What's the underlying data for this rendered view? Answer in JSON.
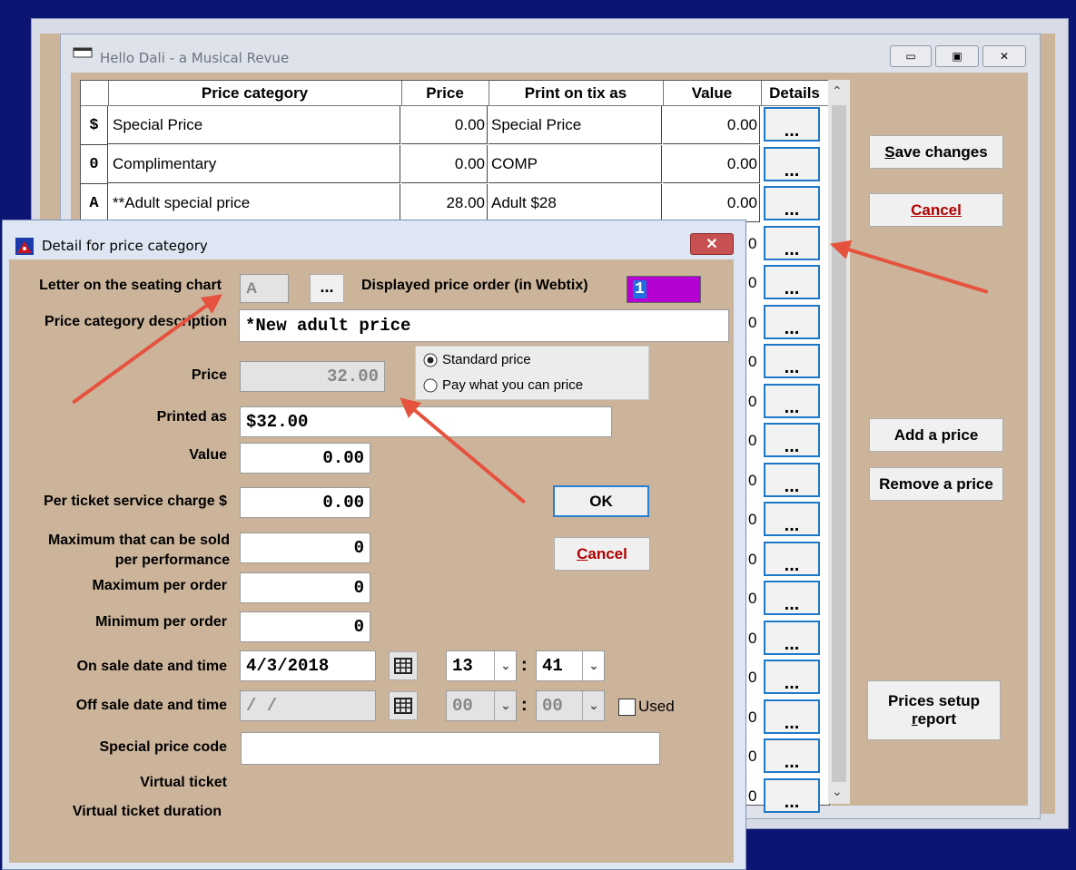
{
  "main_window": {
    "title": "Hello Dali - a Musical Revue",
    "grid": {
      "headers": [
        "Price category",
        "Price",
        "Print on tix as",
        "Value",
        "Details"
      ],
      "rows": [
        {
          "letter": "$",
          "category": "Special Price",
          "price": "0.00",
          "print": "Special Price",
          "value": "0.00"
        },
        {
          "letter": "0",
          "category": "Complimentary",
          "price": "0.00",
          "print": "COMP",
          "value": "0.00"
        },
        {
          "letter": "A",
          "category": "**Adult special price",
          "price": "28.00",
          "print": "Adult $28",
          "value": "0.00"
        }
      ],
      "hidden_value_suffix": "0",
      "details_label": "..."
    },
    "buttons": {
      "save_key": "S",
      "save_rest": "ave changes",
      "cancel_key": "C",
      "cancel_rest": "ancel",
      "add": "Add a price",
      "remove": "Remove a price",
      "report_line1": "Prices setup",
      "report_line2_key": "r",
      "report_line2_rest": "eport"
    }
  },
  "dialog": {
    "title": "Detail for price category",
    "letter_label": "Letter on the seating chart",
    "letter_value": "A",
    "ellipsis": "...",
    "order_label": "Displayed price order (in Webtix)",
    "order_value": "1",
    "desc_label": "Price category description",
    "desc_value": "*New adult price",
    "price_type_options": [
      "Standard price",
      "Pay what you can price"
    ],
    "price_type_selected": "Standard price",
    "price_label": "Price",
    "price_value": "32.00",
    "printed_label": "Printed as",
    "printed_value": "$32.00",
    "value_label": "Value",
    "value_value": "0.00",
    "service_label": "Per ticket service charge  $",
    "service_value": "0.00",
    "max_perf_label1": "Maximum that can be sold",
    "max_perf_label2": "per performance",
    "max_perf_value": "0",
    "max_order_label": "Maximum per order",
    "max_order_value": "0",
    "min_order_label": "Minimum per order",
    "min_order_value": "0",
    "on_sale_label": "On sale date and time",
    "on_sale_date": "4/3/2018",
    "on_sale_hour": "13",
    "on_sale_min": "41",
    "off_sale_label": "Off sale date and time",
    "off_sale_date": " / /",
    "off_sale_hour": "00",
    "off_sale_min": "00",
    "colon": ":",
    "used_label": "Used",
    "special_code_label": "Special price code",
    "special_code_value": "",
    "virtual_label": "Virtual ticket",
    "virtual_duration_label": "Virtual ticket duration",
    "ok_label": "OK",
    "cancel_key": "C",
    "cancel_rest": "ancel"
  },
  "colors": {
    "desktop": "#0c1474",
    "client": "#ccb49b",
    "order_field": "#b400d0",
    "arrow": "#e5533f"
  }
}
